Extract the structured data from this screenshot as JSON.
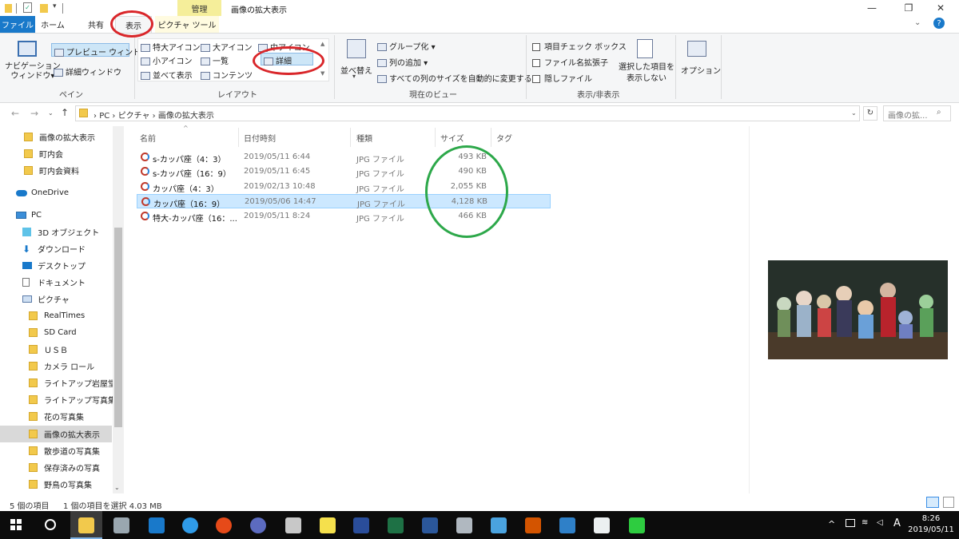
{
  "titlebar": {
    "context_tab": "管理",
    "title": "画像の拡大表示",
    "minimize": "—",
    "maximize": "❐",
    "close": "✕"
  },
  "tabs": {
    "file": "ファイル",
    "home": "ホーム",
    "share": "共有",
    "view": "表示",
    "picture_tools": "ピクチャ ツール",
    "help": "?"
  },
  "ribbon": {
    "pane": {
      "nav_pane": "ナビゲーション\nウィンドウ▾",
      "preview_pane": "プレビュー ウィンドウ",
      "details_pane": "詳細ウィンドウ",
      "label": "ペイン"
    },
    "layout": {
      "extra_large_icons": "特大アイコン",
      "large_icons": "大アイコン",
      "medium_icons": "中アイコン",
      "small_icons": "小アイコン",
      "list": "一覧",
      "details": "詳細",
      "tiles": "並べて表示",
      "content": "コンテンツ",
      "label": "レイアウト"
    },
    "current_view": {
      "sort_by": "並べ替え",
      "group_by": "グループ化 ▾",
      "add_columns": "列の追加 ▾",
      "size_all_columns": "すべての列のサイズを自動的に変更する",
      "label": "現在のビュー"
    },
    "show_hide": {
      "item_check_boxes": "項目チェック ボックス",
      "file_name_extensions": "ファイル名拡張子",
      "hidden_items": "隠しファイル",
      "hide_selected": "選択した項目を\n表示しない",
      "label": "表示/非表示"
    },
    "options": "オプション"
  },
  "address": {
    "path": [
      "PC",
      "ピクチャ",
      "画像の拡大表示"
    ],
    "search_placeholder": "画像の拡..."
  },
  "navpane": {
    "quick": [
      "画像の拡大表示",
      "町内会",
      "町内会資料"
    ],
    "onedrive": "OneDrive",
    "pc": "PC",
    "pc_items": [
      "3D オブジェクト",
      "ダウンロード",
      "デスクトップ",
      "ドキュメント",
      "ピクチャ"
    ],
    "pictures": [
      "RealTimes",
      "SD Card",
      "ＵＳＢ",
      "カメラ ロール",
      "ライトアップ岩屋堂",
      "ライトアップ写真集",
      "花の写真集",
      "画像の拡大表示",
      "散歩道の写真集",
      "保存済みの写真",
      "野鳥の写真集"
    ]
  },
  "columns": {
    "name": "名前",
    "date": "日付時刻",
    "type": "種類",
    "size": "サイズ",
    "tags": "タグ"
  },
  "files": [
    {
      "name": "s-カッパ座（4：3）",
      "date": "2019/05/11 6:44",
      "type": "JPG ファイル",
      "size": "493 KB"
    },
    {
      "name": "s-カッパ座（16：9）",
      "date": "2019/05/11 6:45",
      "type": "JPG ファイル",
      "size": "490 KB"
    },
    {
      "name": "カッパ座（4：3）",
      "date": "2019/02/13 10:48",
      "type": "JPG ファイル",
      "size": "2,055 KB"
    },
    {
      "name": "カッパ座（16：9）",
      "date": "2019/05/06 14:47",
      "type": "JPG ファイル",
      "size": "4,128 KB"
    },
    {
      "name": "特大-カッパ座（16：...",
      "date": "2019/05/11 8:24",
      "type": "JPG ファイル",
      "size": "466 KB"
    }
  ],
  "status": {
    "items": "5 個の項目",
    "selected": "1 個の項目を選択 4.03 MB"
  },
  "taskbar": {
    "ime": "A",
    "time": "8:26",
    "date": "2019/05/11"
  }
}
